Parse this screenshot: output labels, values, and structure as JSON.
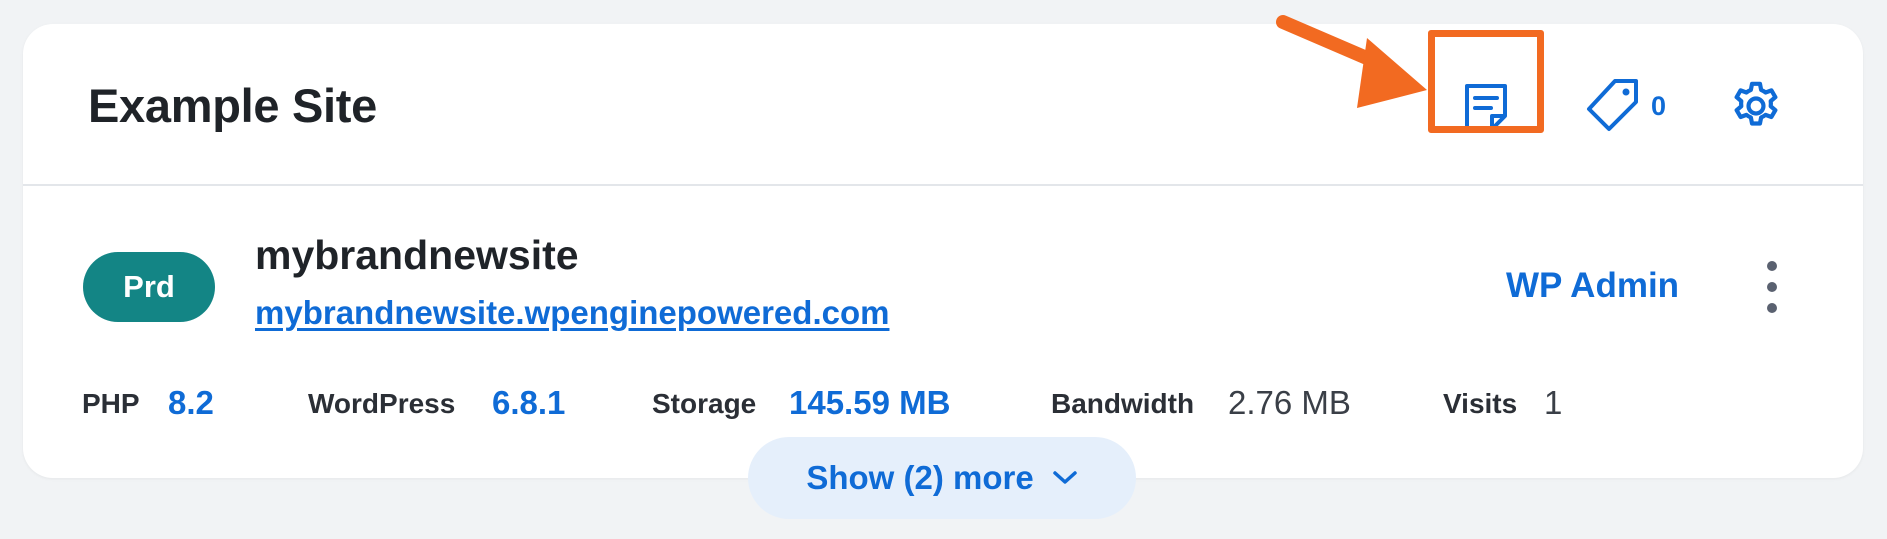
{
  "site": {
    "title": "Example Site",
    "tag_count": "0"
  },
  "environment": {
    "badge": "Prd",
    "name": "mybrandnewsite",
    "url": "mybrandnewsite.wpenginepowered.com",
    "admin_label": "WP Admin"
  },
  "stats": {
    "php_label": "PHP",
    "php_value": "8.2",
    "wordpress_label": "WordPress",
    "wordpress_value": "6.8.1",
    "storage_label": "Storage",
    "storage_value": "145.59 MB",
    "bandwidth_label": "Bandwidth",
    "bandwidth_value": "2.76 MB",
    "visits_label": "Visits",
    "visits_value": "1"
  },
  "show_more": {
    "label": "Show (2) more"
  },
  "icons": {
    "notes": "notes-icon",
    "tag": "tag-icon",
    "settings": "gear-icon",
    "kebab": "more-vertical-icon",
    "chevron": "chevron-down-icon",
    "annotation_arrow": "arrow-icon"
  },
  "colors": {
    "accent_blue": "#0f6bd6",
    "badge_teal": "#138585",
    "highlight_orange": "#f26a21",
    "show_more_bg": "#e5effb"
  }
}
